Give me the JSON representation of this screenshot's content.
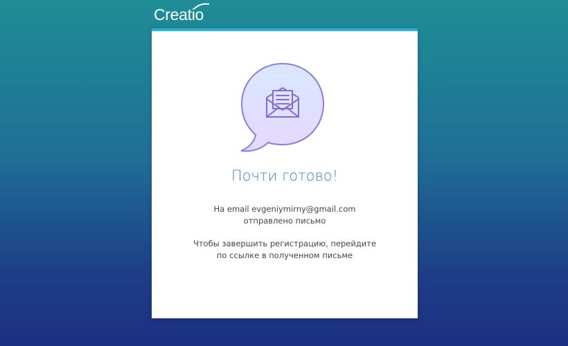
{
  "brand": {
    "logo_text": "Creatio"
  },
  "colors": {
    "accent_bar": "#27b3d1",
    "title": "#3c7fd1",
    "bubble_stroke": "#8b7be6",
    "bubble_fill_top": "#d9e8ff",
    "bubble_fill_bottom": "#e3d6ff"
  },
  "card": {
    "icon": "envelope-speech-bubble-icon",
    "title": "Почти готово!",
    "message_line1": "На email evgeniymirny@gmail.com",
    "message_line2": "отправлено письмо",
    "instruction_line1": "Чтобы завершить регистрацию, перейдите",
    "instruction_line2": "по ссылке в полученном письме"
  }
}
